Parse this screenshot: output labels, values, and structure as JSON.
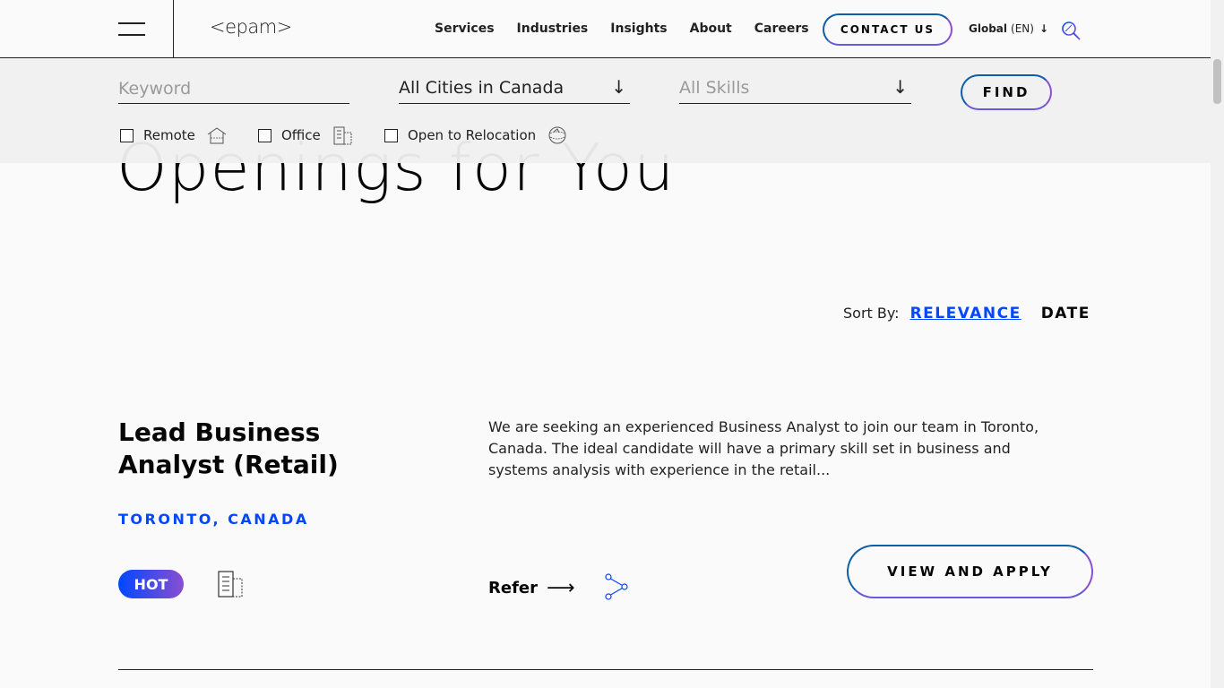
{
  "header": {
    "logo": "<epam>",
    "nav": [
      "Services",
      "Industries",
      "Insights",
      "About",
      "Careers"
    ],
    "contact_label": "CONTACT US",
    "global_label": "Global",
    "global_lang": "(EN)",
    "global_arrow": "↓"
  },
  "filters": {
    "keyword_placeholder": "Keyword",
    "city_value": "All Cities in Canada",
    "skills_placeholder": "All Skills",
    "find_label": "FIND",
    "dropdown_arrow": "↓",
    "checkboxes": [
      {
        "label": "Remote",
        "icon": "home-icon",
        "checked": false
      },
      {
        "label": "Office",
        "icon": "building-icon",
        "checked": false
      },
      {
        "label": "Open to Relocation",
        "icon": "relocation-icon",
        "checked": false
      }
    ]
  },
  "main": {
    "headline": "Openings for You",
    "sort_label": "Sort By:",
    "sort_relevance": "RELEVANCE",
    "sort_date": "DATE"
  },
  "job": {
    "title": "Lead Business Analyst (Retail)",
    "location": "TORONTO, CANADA",
    "badge": "HOT",
    "description": "We are seeking an experienced Business Analyst to join our team in Toronto, Canada. The ideal candidate will have a primary skill set in business and systems analysis with experience in the retail...",
    "refer_label": "Refer",
    "refer_arrow": "⟶",
    "apply_label": "VIEW AND APPLY"
  },
  "colors": {
    "accent_blue": "#0047ff",
    "gradient_purple": "#8a4ed0",
    "text_dark": "#060606"
  }
}
